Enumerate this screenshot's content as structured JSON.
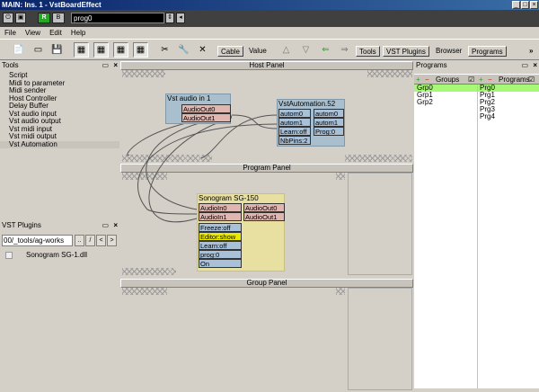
{
  "window": {
    "title": "MAIN: Ins. 1 - VstBoardEffect"
  },
  "host_bar": {
    "record_label": "R",
    "bypass_label": "B",
    "program_value": "prog0"
  },
  "menu": [
    "File",
    "View",
    "Edit",
    "Help"
  ],
  "toolbar": {
    "cable_label": "Cable",
    "value_label": "Value",
    "tools_label": "Tools",
    "vst_plugins_label": "VST Plugins",
    "browser_label": "Browser",
    "programs_label": "Programs",
    "more_label": "»"
  },
  "tools_panel": {
    "title": "Tools",
    "items": [
      "Script",
      "Midi to parameter",
      "Midi sender",
      "Host Controller",
      "Delay Buffer",
      "Vst audio input",
      "Vst audio output",
      "Vst midi input",
      "Vst midi output",
      "Vst Automation"
    ],
    "selected": "Vst Automation"
  },
  "vst_plugins_panel": {
    "title": "VST Plugins",
    "path": "00/_tools/ag-works",
    "nav": [
      "..",
      "/",
      "<",
      ">"
    ],
    "tree_item": "Sonogram SG-1.dll"
  },
  "host_panel": {
    "title": "Host Panel",
    "vst_audio_in": {
      "title": "Vst audio in 1",
      "pins": [
        "AudioOut0",
        "AudioOut1"
      ]
    },
    "vst_automation": {
      "title": "VstAutomation.52",
      "left_pins": [
        "autom0",
        "autom1",
        "Learn:off",
        "NbPins:2"
      ],
      "right_pins": [
        "autom0",
        "autom1",
        "Prog:0"
      ]
    }
  },
  "program_panel": {
    "title": "Program Panel",
    "sonogram": {
      "title": "Sonogram SG-150",
      "inputs": [
        "AudioIn0",
        "AudioIn1"
      ],
      "outputs": [
        "AudioOut0",
        "AudioOut1"
      ],
      "params": [
        "Freeze:off",
        "Editor:show",
        "Learn:off",
        "prog:0",
        "On"
      ]
    }
  },
  "group_panel": {
    "title": "Group Panel"
  },
  "programs_panel": {
    "title": "Programs",
    "groups_header": "Groups",
    "programs_header": "Programs",
    "groups": [
      "Grp0",
      "Grp1",
      "Grp2"
    ],
    "programs": [
      "Prg0",
      "Prg1",
      "Prg2",
      "Prg3",
      "Prg4"
    ],
    "selected_group": "Grp0",
    "selected_program": "Prg0"
  },
  "colors": {
    "selection_green": "#a8f878",
    "node_blue": "#a9bfcd",
    "pin_pink": "#e0b7b0",
    "sonogram_bg": "#e8e0a0",
    "editor_yellow": "#e8e800"
  }
}
